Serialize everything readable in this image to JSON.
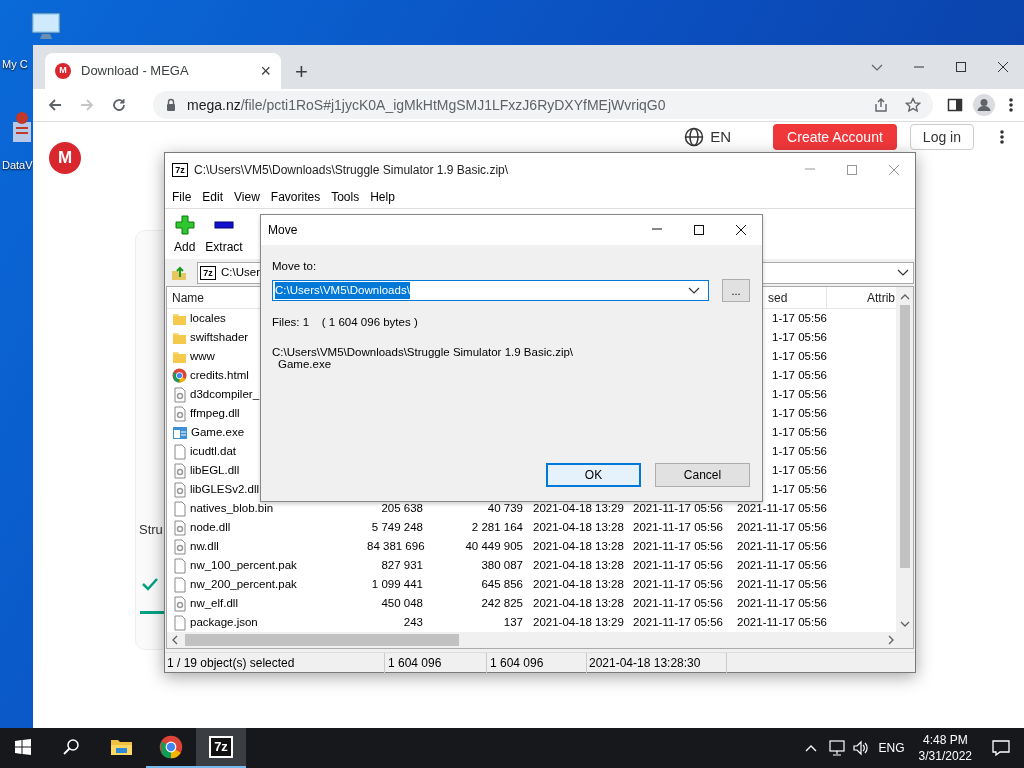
{
  "desktop_icons": [
    {
      "kind": "computer",
      "label": "My C"
    },
    {
      "kind": "data",
      "label": "DataV"
    }
  ],
  "browser": {
    "tab": {
      "favicon": "M",
      "title": "Download - MEGA",
      "close": "×"
    },
    "new_tab": "+",
    "forward_disabled": true,
    "url": {
      "host": "mega.nz",
      "path": "/file/pcti1RoS#j1jycK0A_igMkHtMgSMJ1LFxzJ6RyDXYfMEjWvriqG0"
    }
  },
  "page": {
    "logo": "M",
    "language": "EN",
    "create_account": "Create Account",
    "login": "Log in",
    "card_title": "Stru"
  },
  "archiver": {
    "icon": "7z",
    "title": "C:\\Users\\VM5\\Downloads\\Struggle Simulator 1.9 Basic.zip\\",
    "menu": [
      "File",
      "Edit",
      "View",
      "Favorites",
      "Tools",
      "Help"
    ],
    "toolbar": [
      {
        "kind": "add",
        "label": "Add"
      },
      {
        "kind": "extract",
        "label": "Extract"
      }
    ],
    "path": "C:\\User",
    "columns": [
      "Name",
      "sed",
      "Attrib"
    ],
    "rows": [
      {
        "kind": "folder",
        "name": "locales",
        "accessed": "1-17 05:56"
      },
      {
        "kind": "folder",
        "name": "swiftshader",
        "accessed": "1-17 05:56"
      },
      {
        "kind": "folder",
        "name": "www",
        "accessed": "1-17 05:56"
      },
      {
        "kind": "html",
        "name": "credits.html",
        "accessed": "1-17 05:56"
      },
      {
        "kind": "dll",
        "name": "d3dcompiler_",
        "accessed": "1-17 05:56"
      },
      {
        "kind": "dll",
        "name": "ffmpeg.dll",
        "accessed": "1-17 05:56"
      },
      {
        "kind": "exe",
        "name": "Game.exe",
        "accessed": "1-17 05:56"
      },
      {
        "kind": "file",
        "name": "icudtl.dat",
        "accessed": "1-17 05:56"
      },
      {
        "kind": "dll",
        "name": "libEGL.dll",
        "accessed": "1-17 05:56"
      },
      {
        "kind": "dll",
        "name": "libGLESv2.dll",
        "accessed": "1-17 05:56"
      },
      {
        "kind": "file",
        "name": "natives_blob.bin",
        "size": "205 638",
        "packed": "40 739",
        "modified": "2021-04-18 13:29",
        "created": "2021-11-17 05:56",
        "accessed": "2021-11-17 05:56"
      },
      {
        "kind": "dll",
        "name": "node.dll",
        "size": "5 749 248",
        "packed": "2 281 164",
        "modified": "2021-04-18 13:28",
        "created": "2021-11-17 05:56",
        "accessed": "2021-11-17 05:56"
      },
      {
        "kind": "dll",
        "name": "nw.dll",
        "size": "84 381 696",
        "packed": "40 449 905",
        "modified": "2021-04-18 13:28",
        "created": "2021-11-17 05:56",
        "accessed": "2021-11-17 05:56"
      },
      {
        "kind": "file",
        "name": "nw_100_percent.pak",
        "size": "827 931",
        "packed": "380 087",
        "modified": "2021-04-18 13:28",
        "created": "2021-11-17 05:56",
        "accessed": "2021-11-17 05:56"
      },
      {
        "kind": "file",
        "name": "nw_200_percent.pak",
        "size": "1 099 441",
        "packed": "645 856",
        "modified": "2021-04-18 13:28",
        "created": "2021-11-17 05:56",
        "accessed": "2021-11-17 05:56"
      },
      {
        "kind": "dll",
        "name": "nw_elf.dll",
        "size": "450 048",
        "packed": "242 825",
        "modified": "2021-04-18 13:28",
        "created": "2021-11-17 05:56",
        "accessed": "2021-11-17 05:56"
      },
      {
        "kind": "file",
        "name": "package.json",
        "size": "243",
        "packed": "137",
        "modified": "2021-04-18 13:29",
        "created": "2021-11-17 05:56",
        "accessed": "2021-11-17 05:56"
      }
    ],
    "status_bar": [
      "1 / 19 object(s) selected",
      "1 604 096",
      "1 604 096",
      "2021-04-18 13:28:30"
    ]
  },
  "dialog": {
    "title": "Move",
    "label": "Move to:",
    "path": "C:\\Users\\VM5\\Downloads\\",
    "path_selected": true,
    "browse": "...",
    "files": "Files: 1    ( 1 604 096 bytes )",
    "source_lines": [
      "C:\\Users\\VM5\\Downloads\\Struggle Simulator 1.9 Basic.zip\\",
      "Game.exe"
    ],
    "buttons": [
      {
        "label": "OK",
        "default": true
      },
      {
        "label": "Cancel",
        "default": false
      }
    ]
  },
  "taskbar": {
    "apps": [
      {
        "kind": "explorer",
        "running": false,
        "active": false
      },
      {
        "kind": "chrome",
        "running": true,
        "active": false
      },
      {
        "kind": "7z",
        "label": "7z",
        "running": true,
        "active": true
      }
    ],
    "language": "ENG",
    "time": "4:48 PM",
    "date": "3/31/2022"
  }
}
